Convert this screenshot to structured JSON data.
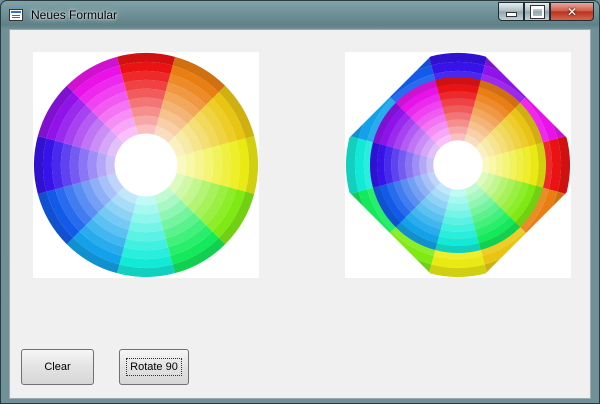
{
  "window": {
    "title": "Neues Formular",
    "controls": {
      "minimize": "minimize",
      "maximize": "maximize",
      "close": "✕"
    }
  },
  "images": {
    "original": {
      "icon": "color-wheel"
    },
    "rotated": {
      "icon": "color-wheel-rotated"
    }
  },
  "buttons": {
    "clear": "Clear",
    "rotate": "Rotate 90"
  },
  "colors": {
    "window_frame": "#6f9197",
    "client_bg": "#f0f0f0",
    "close_button": "#c8462f"
  }
}
